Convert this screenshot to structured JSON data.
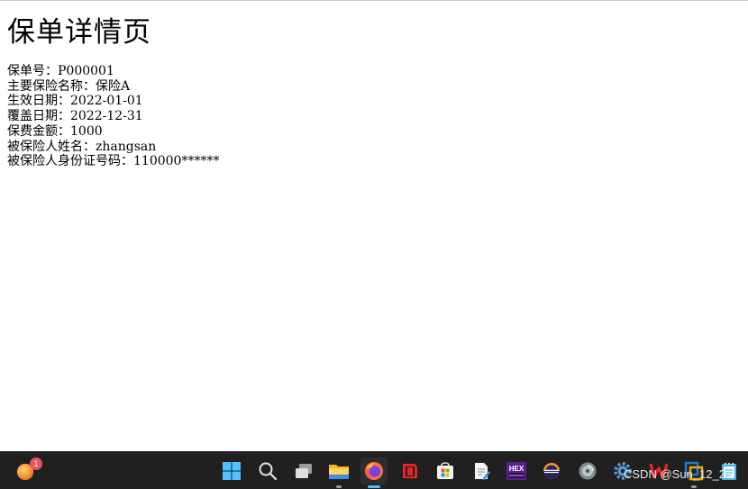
{
  "page": {
    "title": "保单详情页",
    "details": [
      {
        "label": "保单号：",
        "value": "P000001"
      },
      {
        "label": "主要保险名称：",
        "value": "保险A"
      },
      {
        "label": "生效日期：",
        "value": "2022-01-01"
      },
      {
        "label": "覆盖日期：",
        "value": "2022-12-31"
      },
      {
        "label": "保费金额：",
        "value": "1000"
      },
      {
        "label": "被保险人姓名：",
        "value": "zhangsan"
      },
      {
        "label": "被保险人身份证号码：",
        "value": "110000******"
      }
    ]
  },
  "taskbar": {
    "weather_badge": "1",
    "watermark": "CSDN @Sun_12_2",
    "icons": [
      "start-icon",
      "search-icon",
      "task-view-icon",
      "file-explorer-icon",
      "firefox-icon",
      "red-app-icon",
      "microsoft-store-icon",
      "notepad-edit-icon",
      "hex-editor-icon",
      "eclipse-icon",
      "disk-tool-icon",
      "settings-gear-icon",
      "wps-icon",
      "virtualbox-icon",
      "notepad-icon"
    ]
  }
}
